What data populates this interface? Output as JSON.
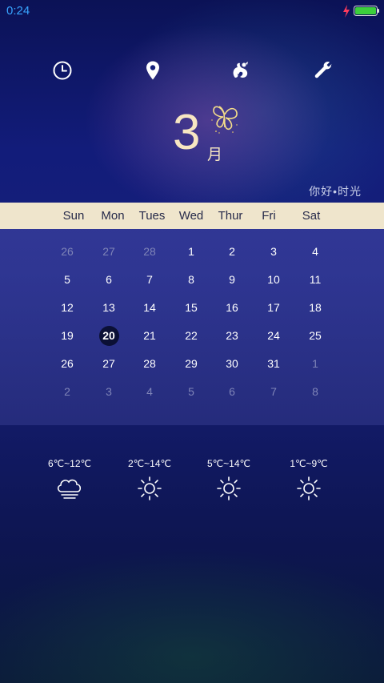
{
  "status": {
    "time": "0:24",
    "charging_icon": "charging-bolt-icon",
    "battery_icon": "battery-full-icon",
    "battery_color": "#3ccf3c"
  },
  "toolbar": {
    "icons": [
      "clock-icon",
      "location-pin-icon",
      "squirrel-browser-icon",
      "wrench-icon"
    ]
  },
  "month": {
    "number": "3",
    "suffix": "月",
    "decoration_icon": "butterfly-icon",
    "color": "#f7e6c2"
  },
  "greeting": "你好•时光",
  "calendar": {
    "weekdays": [
      "Sun",
      "Mon",
      "Tues",
      "Wed",
      "Thur",
      "Fri",
      "Sat"
    ],
    "weeks": [
      [
        "26",
        "27",
        "28",
        "1",
        "2",
        "3",
        "4"
      ],
      [
        "5",
        "6",
        "7",
        "8",
        "9",
        "10",
        "11"
      ],
      [
        "12",
        "13",
        "14",
        "15",
        "16",
        "17",
        "18"
      ],
      [
        "19",
        "20",
        "21",
        "22",
        "23",
        "24",
        "25"
      ],
      [
        "26",
        "27",
        "28",
        "29",
        "30",
        "31",
        "1"
      ],
      [
        "2",
        "3",
        "4",
        "5",
        "6",
        "7",
        "8"
      ]
    ],
    "today": "20",
    "header_bg": "#efe5cc"
  },
  "weather": [
    {
      "range": "6℃~12℃",
      "icon": "cloud-fog-icon"
    },
    {
      "range": "2℃~14℃",
      "icon": "sun-icon"
    },
    {
      "range": "5℃~14℃",
      "icon": "sun-icon"
    },
    {
      "range": "1℃~9℃",
      "icon": "sun-icon"
    }
  ]
}
